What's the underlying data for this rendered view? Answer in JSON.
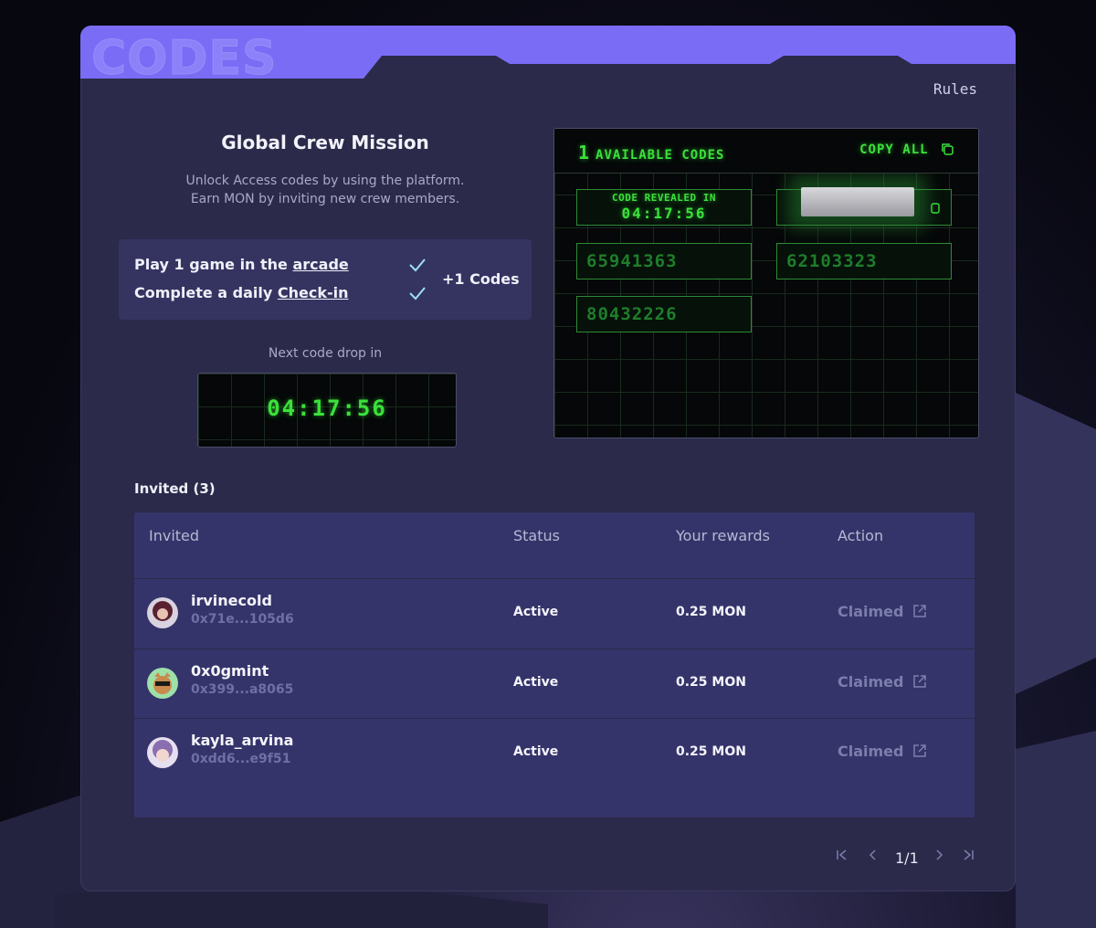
{
  "panel_title": "CODES",
  "rules_link": "Rules",
  "mission": {
    "title": "Global Crew Mission",
    "desc_line1": "Unlock Access codes by using the platform.",
    "desc_line2": "Earn MON by inviting new crew members.",
    "tasks": [
      {
        "prefix": "Play 1 game in the ",
        "link": "arcade"
      },
      {
        "prefix": "Complete a daily ",
        "link": "Check-in"
      }
    ],
    "reward": "+1 Codes",
    "next_drop_label": "Next code drop in",
    "next_drop_timer": "04:17:56"
  },
  "codes_panel": {
    "available_count": "1",
    "available_label": "AVAILABLE CODES",
    "copy_all": "COPY ALL",
    "reveal_label": "CODE REVEALED IN",
    "reveal_timer": "04:17:56",
    "codes": [
      "65941363",
      "62103323",
      "80432226"
    ]
  },
  "invited": {
    "label": "Invited (3)",
    "columns": [
      "Invited",
      "Status",
      "Your rewards",
      "Action"
    ],
    "rows": [
      {
        "name": "irvinecold",
        "address": "0x71e...105d6",
        "status": "Active",
        "reward": "0.25 MON",
        "action": "Claimed"
      },
      {
        "name": "0x0gmint",
        "address": "0x399...a8065",
        "status": "Active",
        "reward": "0.25 MON",
        "action": "Claimed"
      },
      {
        "name": "kayla_arvina",
        "address": "0xdd6...e9f51",
        "status": "Active",
        "reward": "0.25 MON",
        "action": "Claimed"
      }
    ]
  },
  "pagination": {
    "page": "1/1"
  },
  "colors": {
    "accent": "#7b6cf6",
    "lcd_green": "#3be13b",
    "panel": "#2b2a4a"
  }
}
